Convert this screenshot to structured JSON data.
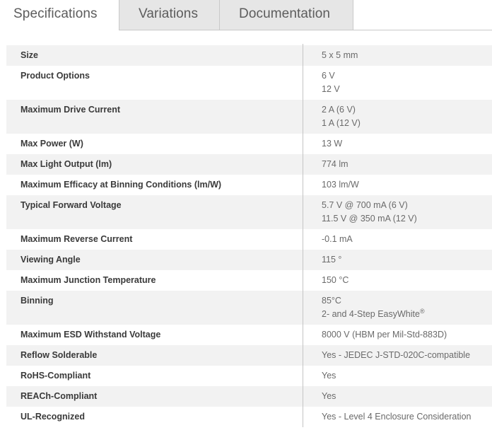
{
  "tabs": [
    {
      "label": "Specifications",
      "active": true
    },
    {
      "label": "Variations",
      "active": false
    },
    {
      "label": "Documentation",
      "active": false
    }
  ],
  "specs": [
    {
      "label": "Size",
      "values": [
        "5 x 5 mm"
      ]
    },
    {
      "label": "Product Options",
      "values": [
        "6 V",
        "12 V"
      ]
    },
    {
      "label": "Maximum Drive Current",
      "values": [
        "2 A (6 V)",
        "1 A (12 V)"
      ]
    },
    {
      "label": "Max Power (W)",
      "values": [
        "13 W"
      ]
    },
    {
      "label": "Max Light Output (lm)",
      "values": [
        "774 lm"
      ]
    },
    {
      "label": "Maximum Efficacy at Binning Conditions (lm/W)",
      "values": [
        "103 lm/W"
      ]
    },
    {
      "label": "Typical Forward Voltage",
      "values": [
        "5.7 V @ 700 mA (6 V)",
        "11.5 V @ 350 mA (12 V)"
      ]
    },
    {
      "label": "Maximum Reverse Current",
      "values": [
        "-0.1 mA"
      ]
    },
    {
      "label": "Viewing Angle",
      "values": [
        "115 °"
      ]
    },
    {
      "label": "Maximum Junction Temperature",
      "values": [
        "150 °C"
      ]
    },
    {
      "label": "Binning",
      "values": [
        "85°C",
        "2- and 4-Step EasyWhite"
      ],
      "superscript": "®"
    },
    {
      "label": "Maximum ESD Withstand Voltage",
      "values": [
        "8000 V (HBM per Mil-Std-883D)"
      ]
    },
    {
      "label": "Reflow Solderable",
      "values": [
        "Yes - JEDEC J-STD-020C-compatible"
      ]
    },
    {
      "label": "RoHS-Compliant",
      "values": [
        "Yes"
      ]
    },
    {
      "label": "REACh-Compliant",
      "values": [
        "Yes"
      ]
    },
    {
      "label": "UL-Recognized",
      "values": [
        "Yes - Level 4 Enclosure Consideration"
      ]
    }
  ],
  "colors": {
    "row_shade": "#f2f2f2",
    "tab_inactive": "#e6e6e6",
    "label_text": "#3a3a3a",
    "value_text": "#6a6a6a"
  }
}
